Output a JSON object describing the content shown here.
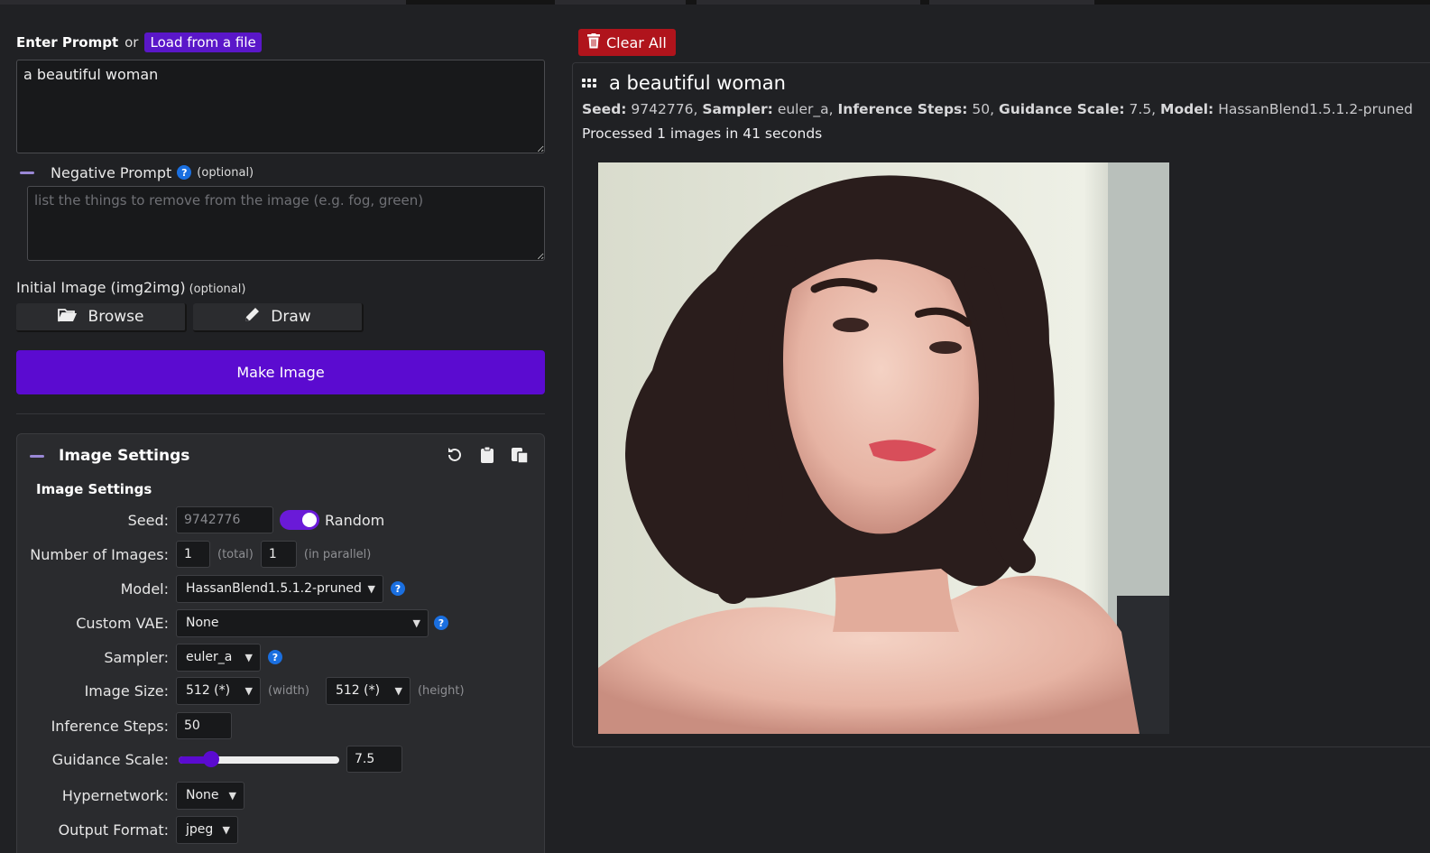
{
  "prompt": {
    "label": "Enter Prompt",
    "or": "or",
    "load_button": "Load from a file",
    "value": "a beautiful woman"
  },
  "negative": {
    "label": "Negative Prompt",
    "optional": "(optional)",
    "placeholder": "list the things to remove from the image (e.g. fog, green)"
  },
  "initial_image": {
    "label": "Initial Image (img2img)",
    "optional": "(optional)",
    "browse": "Browse",
    "draw": "Draw"
  },
  "make_image": "Make Image",
  "settings": {
    "header": "Image Settings",
    "subheader": "Image Settings",
    "seed": {
      "label": "Seed:",
      "value": "9742776",
      "toggle_label": "Random"
    },
    "num_images": {
      "label": "Number of Images:",
      "total": "1",
      "total_note": "(total)",
      "parallel": "1",
      "parallel_note": "(in parallel)"
    },
    "model": {
      "label": "Model:",
      "value": "HassanBlend1.5.1.2-pruned"
    },
    "vae": {
      "label": "Custom VAE:",
      "value": "None"
    },
    "sampler": {
      "label": "Sampler:",
      "value": "euler_a"
    },
    "size": {
      "label": "Image Size:",
      "width": "512 (*)",
      "width_note": "(width)",
      "height": "512 (*)",
      "height_note": "(height)"
    },
    "steps": {
      "label": "Inference Steps:",
      "value": "50"
    },
    "guidance": {
      "label": "Guidance Scale:",
      "value": "7.5",
      "fraction": 0.2
    },
    "hypernetwork": {
      "label": "Hypernetwork:",
      "value": "None"
    },
    "output_format": {
      "label": "Output Format:",
      "value": "jpeg"
    }
  },
  "result": {
    "clear_all": "Clear All",
    "title": "a beautiful woman",
    "meta": {
      "seed_label": "Seed:",
      "seed": "9742776,",
      "sampler_label": "Sampler:",
      "sampler": "euler_a,",
      "steps_label": "Inference Steps:",
      "steps": "50,",
      "guidance_label": "Guidance Scale:",
      "guidance": "7.5,",
      "model_label": "Model:",
      "model": "HassanBlend1.5.1.2-pruned"
    },
    "processed": "Processed 1 images in 41 seconds"
  },
  "colors": {
    "accent": "#5b0bd0",
    "clear": "#b0141c",
    "help": "#1a6fe0"
  },
  "icons": {
    "browse": "folder-open-icon",
    "draw": "pencil-icon",
    "clear": "trash-icon",
    "reset": "reset-icon",
    "copy": "clipboard-icon",
    "paste": "paste-icon",
    "help": "help-icon",
    "result": "grid-icon"
  }
}
